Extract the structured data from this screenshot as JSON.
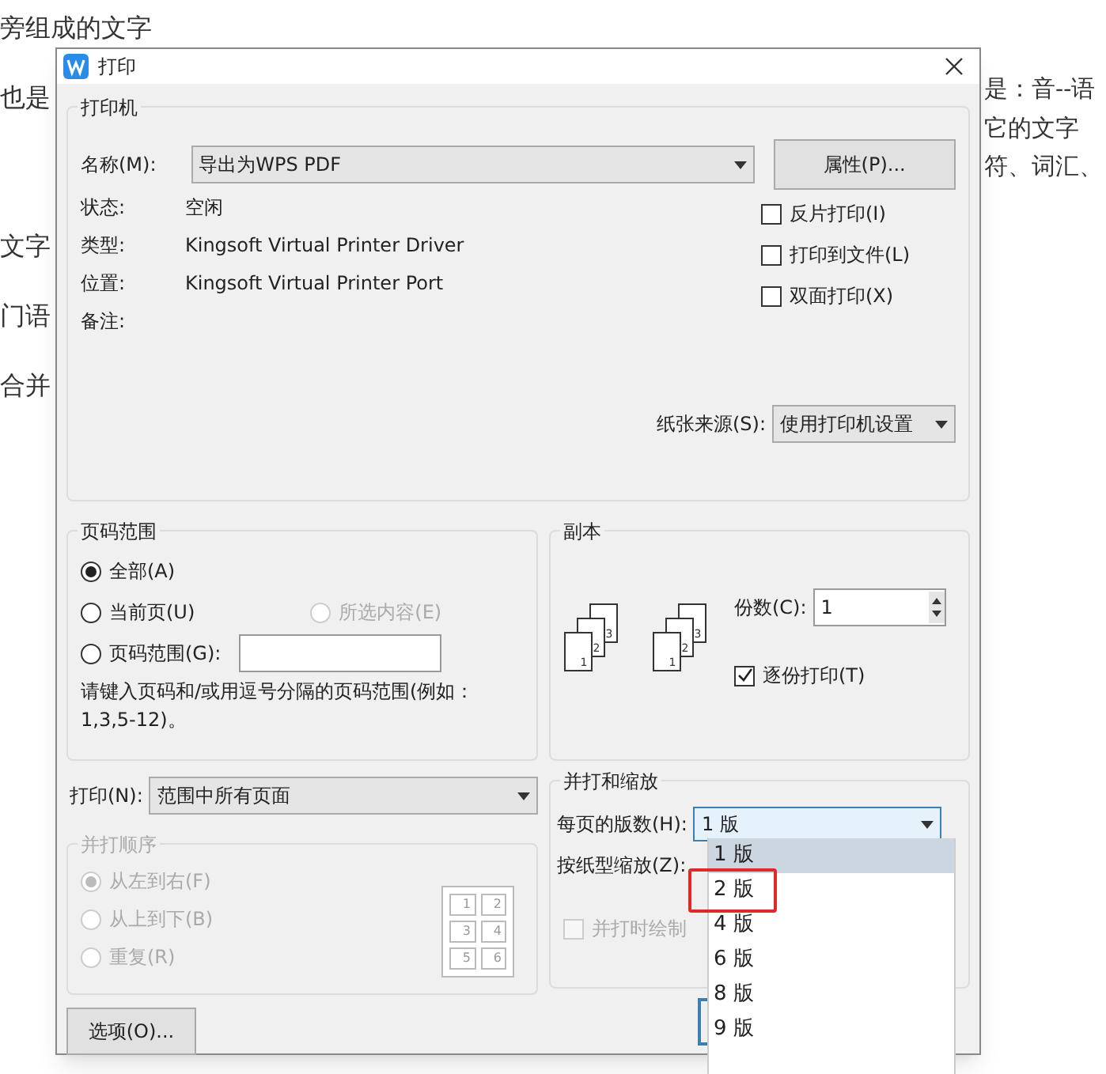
{
  "background_document": {
    "left_lines": [
      "旁组成的文字",
      "也是",
      "文字",
      "门语",
      "合并"
    ],
    "right_lines": [
      "是：音--语",
      "它的文字",
      "符、词汇、"
    ]
  },
  "window": {
    "title": "打印"
  },
  "printer": {
    "group_title": "打印机",
    "name_label": "名称(M):",
    "name_value": "导出为WPS PDF",
    "properties_button": "属性(P)...",
    "info": [
      {
        "label": "状态:",
        "value": "空闲"
      },
      {
        "label": "类型:",
        "value": "Kingsoft Virtual Printer Driver"
      },
      {
        "label": "位置:",
        "value": "Kingsoft Virtual Printer Port"
      },
      {
        "label": "备注:"
      }
    ],
    "options": [
      {
        "label": "反片打印(I)",
        "checked": false
      },
      {
        "label": "打印到文件(L)",
        "checked": false
      },
      {
        "label": "双面打印(X)",
        "checked": false
      }
    ],
    "paper_source_label": "纸张来源(S):",
    "paper_source_value": "使用打印机设置"
  },
  "page_range": {
    "group_title": "页码范围",
    "options": [
      {
        "label": "全部(A)",
        "selected": true,
        "disabled": false
      },
      {
        "label": "当前页(U)",
        "selected": false,
        "disabled": false
      },
      {
        "label": "所选内容(E)",
        "selected": false,
        "disabled": true
      },
      {
        "label": "页码范围(G):",
        "selected": false,
        "disabled": false
      }
    ],
    "hint": "请键入页码和/或用逗号分隔的页码范围(例如：1,3,5-12)。"
  },
  "print_what": {
    "label": "打印(N):",
    "value": "范围中所有页面"
  },
  "collate_order": {
    "group_title": "并打顺序",
    "disabled": true,
    "options": [
      {
        "label": "从左到右(F)",
        "selected": true
      },
      {
        "label": "从上到下(B)",
        "selected": false
      },
      {
        "label": "重复(R)",
        "selected": false
      }
    ],
    "preview": [
      "1",
      "2",
      "3",
      "4",
      "5",
      "6"
    ]
  },
  "options_button": "选项(O)...",
  "copies": {
    "group_title": "副本",
    "stacks": [
      {
        "pages": [
          "1",
          "2",
          "3"
        ]
      },
      {
        "pages": [
          "1",
          "2",
          "3"
        ]
      }
    ],
    "count_label": "份数(C):",
    "count_value": "1",
    "collate": {
      "label": "逐份打印(T)",
      "checked": true
    }
  },
  "zoom": {
    "group_title": "并打和缩放",
    "pages_per_sheet_label": "每页的版数(H):",
    "pages_per_sheet_value": "1 版",
    "scale_label": "按纸型缩放(Z):",
    "draw_borders": {
      "label": "并打时绘制",
      "checked": false,
      "disabled": true
    },
    "dropdown": [
      {
        "label": "1 版",
        "selected": true,
        "highlighted": false
      },
      {
        "label": "2 版",
        "selected": false,
        "highlighted": true
      },
      {
        "label": "4 版",
        "selected": false,
        "highlighted": false
      },
      {
        "label": "6 版",
        "selected": false,
        "highlighted": false
      },
      {
        "label": "8 版",
        "selected": false,
        "highlighted": false
      },
      {
        "label": "9 版",
        "selected": false,
        "highlighted": false
      }
    ]
  }
}
